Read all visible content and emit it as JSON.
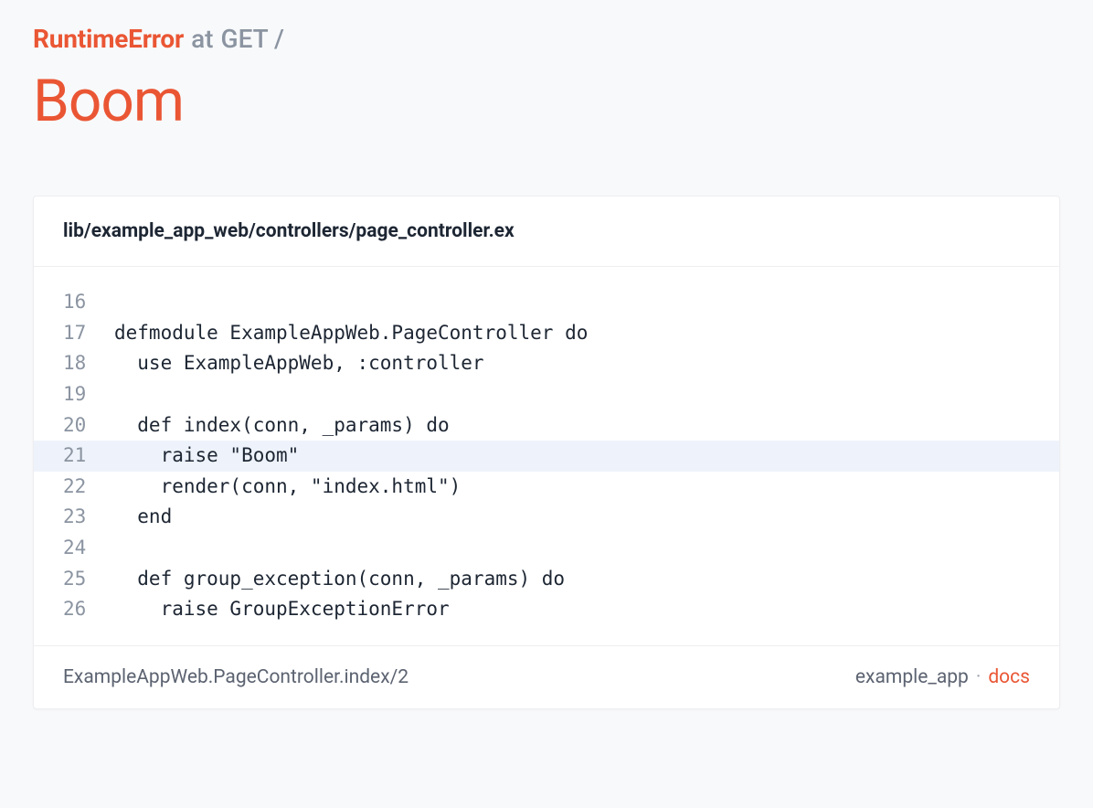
{
  "header": {
    "error_class": "RuntimeError",
    "at_label": "at",
    "request": "GET /",
    "error_message": "Boom"
  },
  "frame": {
    "file_path": "lib/example_app_web/controllers/page_controller.ex",
    "highlight_line": 21,
    "lines": [
      {
        "no": 16,
        "src": ""
      },
      {
        "no": 17,
        "src": "defmodule ExampleAppWeb.PageController do"
      },
      {
        "no": 18,
        "src": "  use ExampleAppWeb, :controller"
      },
      {
        "no": 19,
        "src": ""
      },
      {
        "no": 20,
        "src": "  def index(conn, _params) do"
      },
      {
        "no": 21,
        "src": "    raise \"Boom\""
      },
      {
        "no": 22,
        "src": "    render(conn, \"index.html\")"
      },
      {
        "no": 23,
        "src": "  end"
      },
      {
        "no": 24,
        "src": ""
      },
      {
        "no": 25,
        "src": "  def group_exception(conn, _params) do"
      },
      {
        "no": 26,
        "src": "    raise GroupExceptionError"
      }
    ],
    "function": "ExampleAppWeb.PageController.index/2",
    "app_name": "example_app",
    "separator": "·",
    "docs_label": "docs"
  }
}
